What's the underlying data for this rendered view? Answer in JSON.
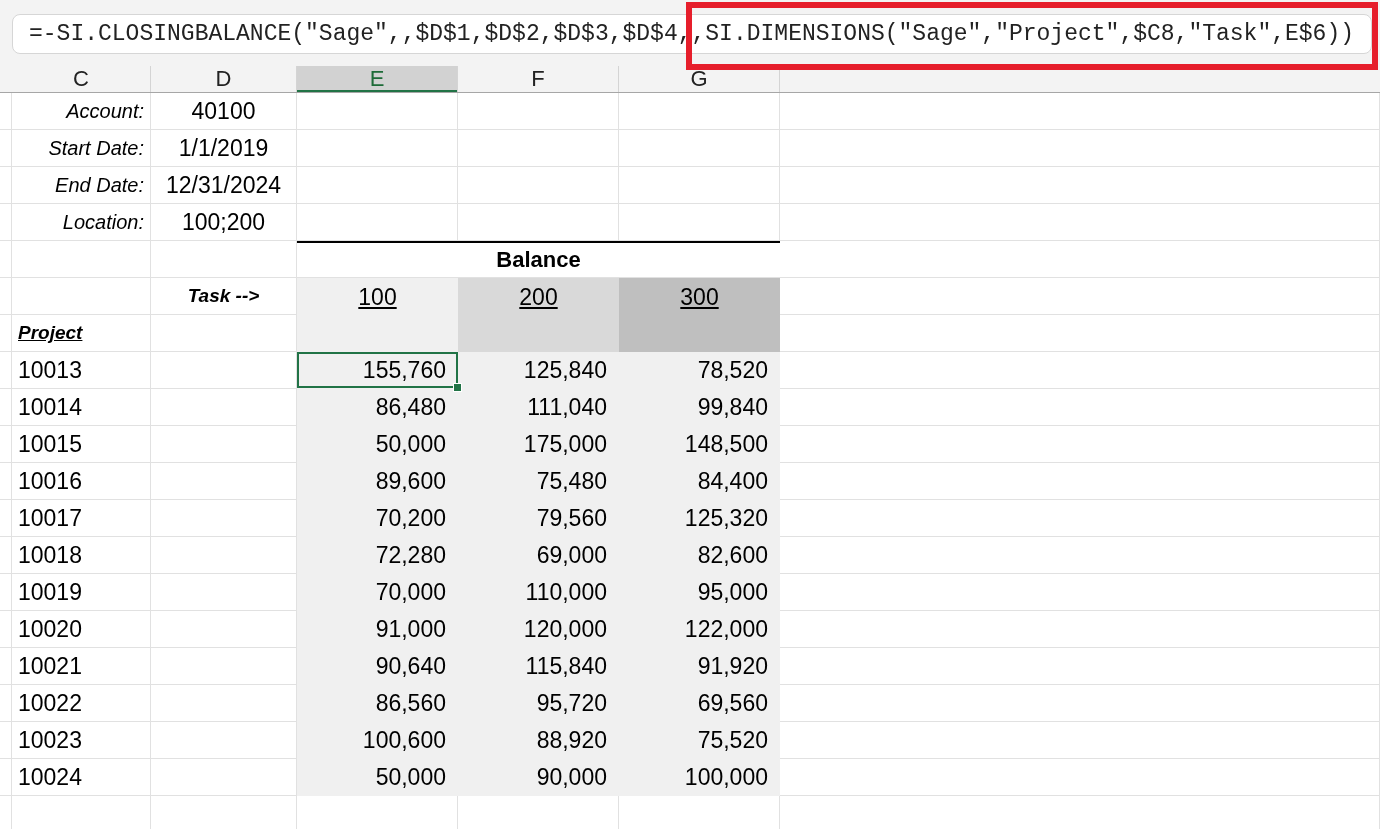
{
  "formula_bar": {
    "segments": [
      {
        "text": "=-SI.CLOSINGBALANCE(\"Sage\",,$D$1,$D$2,$D$3,$D$4,,",
        "highlighted": false
      },
      {
        "text": "SI.DIMENSIONS(\"Sage\",\"Project\",$C8,\"Task\",E$6))",
        "highlighted": true
      }
    ]
  },
  "column_headers": [
    {
      "label": "C",
      "selected": false
    },
    {
      "label": "D",
      "selected": false
    },
    {
      "label": "E",
      "selected": true
    },
    {
      "label": "F",
      "selected": false
    },
    {
      "label": "G",
      "selected": false
    }
  ],
  "parameters": [
    {
      "label": "Account:",
      "value": "40100"
    },
    {
      "label": "Start Date:",
      "value": "1/1/2019"
    },
    {
      "label": "End Date:",
      "value": "12/31/2024"
    },
    {
      "label": "Location:",
      "value": "100;200"
    }
  ],
  "table": {
    "title": "Balance",
    "column_axis_label": "Task -->",
    "row_axis_label": "Project",
    "columns": [
      {
        "label": "100",
        "color": "#f0f0f0"
      },
      {
        "label": "200",
        "color": "#d9d9d9"
      },
      {
        "label": "300",
        "color": "#bfbfbf"
      }
    ],
    "rows": [
      {
        "project": "10013",
        "cells": [
          {
            "value": "155,760",
            "selected": true
          },
          {
            "value": "125,840",
            "selected": false
          },
          {
            "value": "78,520",
            "selected": false
          }
        ]
      },
      {
        "project": "10014",
        "cells": [
          {
            "value": "86,480",
            "selected": false
          },
          {
            "value": "111,040",
            "selected": false
          },
          {
            "value": "99,840",
            "selected": false
          }
        ]
      },
      {
        "project": "10015",
        "cells": [
          {
            "value": "50,000",
            "selected": false
          },
          {
            "value": "175,000",
            "selected": false
          },
          {
            "value": "148,500",
            "selected": false
          }
        ]
      },
      {
        "project": "10016",
        "cells": [
          {
            "value": "89,600",
            "selected": false
          },
          {
            "value": "75,480",
            "selected": false
          },
          {
            "value": "84,400",
            "selected": false
          }
        ]
      },
      {
        "project": "10017",
        "cells": [
          {
            "value": "70,200",
            "selected": false
          },
          {
            "value": "79,560",
            "selected": false
          },
          {
            "value": "125,320",
            "selected": false
          }
        ]
      },
      {
        "project": "10018",
        "cells": [
          {
            "value": "72,280",
            "selected": false
          },
          {
            "value": "69,000",
            "selected": false
          },
          {
            "value": "82,600",
            "selected": false
          }
        ]
      },
      {
        "project": "10019",
        "cells": [
          {
            "value": "70,000",
            "selected": false
          },
          {
            "value": "110,000",
            "selected": false
          },
          {
            "value": "95,000",
            "selected": false
          }
        ]
      },
      {
        "project": "10020",
        "cells": [
          {
            "value": "91,000",
            "selected": false
          },
          {
            "value": "120,000",
            "selected": false
          },
          {
            "value": "122,000",
            "selected": false
          }
        ]
      },
      {
        "project": "10021",
        "cells": [
          {
            "value": "90,640",
            "selected": false
          },
          {
            "value": "115,840",
            "selected": false
          },
          {
            "value": "91,920",
            "selected": false
          }
        ]
      },
      {
        "project": "10022",
        "cells": [
          {
            "value": "86,560",
            "selected": false
          },
          {
            "value": "95,720",
            "selected": false
          },
          {
            "value": "69,560",
            "selected": false
          }
        ]
      },
      {
        "project": "10023",
        "cells": [
          {
            "value": "100,600",
            "selected": false
          },
          {
            "value": "88,920",
            "selected": false
          },
          {
            "value": "75,520",
            "selected": false
          }
        ]
      },
      {
        "project": "10024",
        "cells": [
          {
            "value": "50,000",
            "selected": false
          },
          {
            "value": "90,000",
            "selected": false
          },
          {
            "value": "100,000",
            "selected": false
          }
        ]
      }
    ]
  }
}
